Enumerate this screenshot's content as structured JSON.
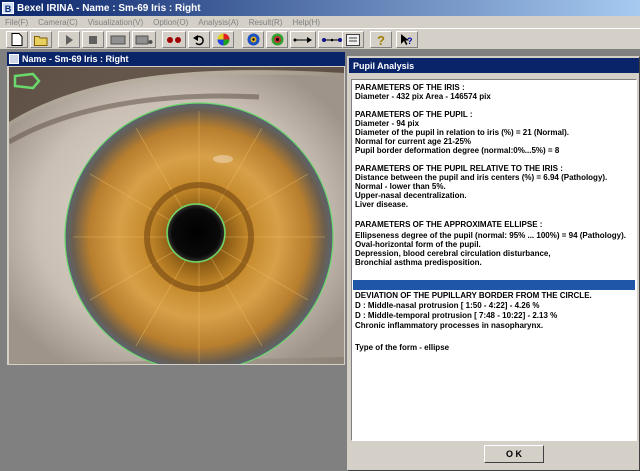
{
  "window": {
    "title": "Bexel IRINA - Name : Sm-69    Iris :  Right",
    "icon": "app-icon-B",
    "icon_text": "B"
  },
  "menu": [
    "File(F)",
    "Camera(C)",
    "Visualization(V)",
    "Option(O)",
    "Analysis(A)",
    "Result(R)",
    "Help(H)"
  ],
  "toolbar": {
    "buttons": [
      "new-icon",
      "open-icon",
      "play-icon",
      "stop-icon",
      "capture-icon",
      "camera-icon",
      "dots-icon",
      "undo-icon",
      "color-wheel-icon",
      "iris-color-icon",
      "iris-zone-icon",
      "measure-line-icon",
      "measure-points-icon",
      "document-icon",
      "hint-icon",
      "context-help-icon"
    ]
  },
  "image_panel": {
    "caption": "Name - Sm-69      Iris :  Right"
  },
  "pupil_analysis": {
    "title": "Pupil Analysis",
    "lines": [
      "PARAMETERS OF THE IRIS :",
      "Diameter - 432 pix                  Area - 146574 pix",
      "",
      "    PARAMETERS OF THE PUPIL :",
      "Diameter -  94 pix",
      "Diameter of the pupil in relation to iris (%) = 21 (Normal).",
      "Normal for current age  21-25%",
      "Pupil border deformation degree (normal:0%...5%) =  8",
      "",
      "    PARAMETERS OF THE PUPIL RELATIVE TO THE IRIS :",
      "Distance between the pupil and iris centers (%) =  6.94 (Pathology).",
      "Normal - lower than 5%.",
      "Upper-nasal decentralization.",
      "Liver disease.",
      "",
      "    PARAMETERS OF THE  APPROXIMATE ELLIPSE :",
      "Ellipseness degree of the pupil (normal: 95% ... 100%) = 94  (Pathology).",
      "Oval-horizontal form of the pupil.",
      "Depression, blood cerebral circulation disturbance,",
      "Bronchial asthma predisposition.",
      "",
      "    DEVIATION OF THE PUPILLARY BORDER FROM THE CIRCLE.",
      "D : Middle-nasal protrusion [ 1:50 -  4:22] - 4.26 %",
      "D : Middle-temporal protrusion [ 7:48 - 10:22] - 2.13 %",
      "Chronic inflammatory processes in nasopharynx.",
      "",
      "Type of the form - ellipse"
    ],
    "ok_label": "O K"
  }
}
